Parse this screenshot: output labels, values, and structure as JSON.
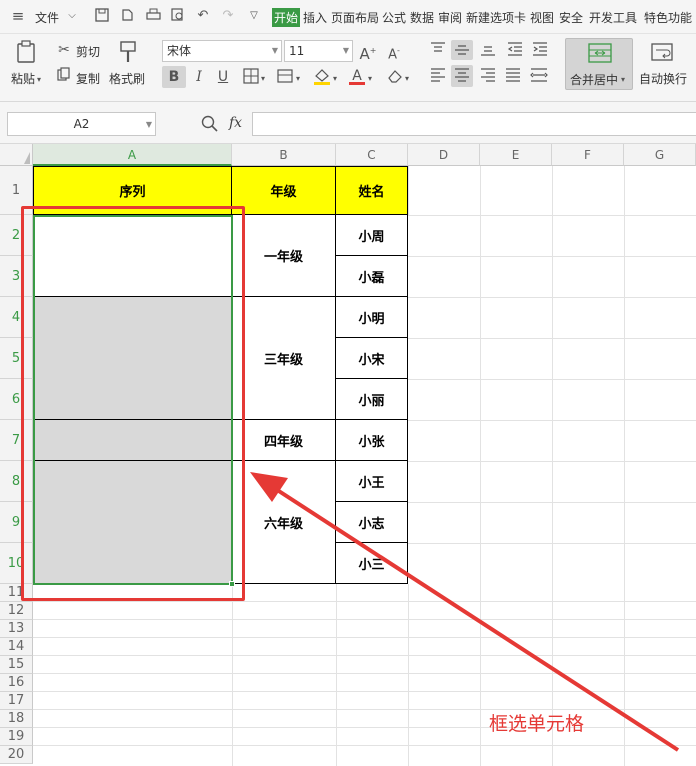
{
  "menu": {
    "file_label": "文件",
    "tabs": [
      "开始",
      "插入",
      "页面布局",
      "公式",
      "数据",
      "审阅",
      "新建选项卡",
      "视图",
      "安全",
      "开发工具",
      "特色功能"
    ]
  },
  "ribbon": {
    "paste": "粘贴",
    "cut": "剪切",
    "copy": "复制",
    "format_painter": "格式刷",
    "font_name": "宋体",
    "font_size": "11",
    "merge_center": "合并居中",
    "wrap_text": "自动换行"
  },
  "formula_bar": {
    "name_box": "A2",
    "fx": "fx",
    "value": ""
  },
  "columns": [
    "A",
    "B",
    "C",
    "D",
    "E",
    "F",
    "G"
  ],
  "rows": [
    "1",
    "2",
    "3",
    "4",
    "5",
    "6",
    "7",
    "8",
    "9",
    "10",
    "11",
    "12",
    "13",
    "14",
    "15",
    "16",
    "17",
    "18",
    "19",
    "20"
  ],
  "header": {
    "a": "序列",
    "b": "年级",
    "c": "姓名"
  },
  "grades": [
    "一年级",
    "三年级",
    "四年级",
    "六年级"
  ],
  "names": [
    "小周",
    "小磊",
    "小明",
    "小宋",
    "小丽",
    "小张",
    "小王",
    "小志",
    "小三"
  ],
  "annotation": "框选单元格",
  "colors": {
    "header_fill": "#ffff00",
    "selection_fill": "#d9d9d9",
    "selection_border": "#3a9a45",
    "annotation": "#e53935",
    "active_tab": "#3a9a45"
  }
}
